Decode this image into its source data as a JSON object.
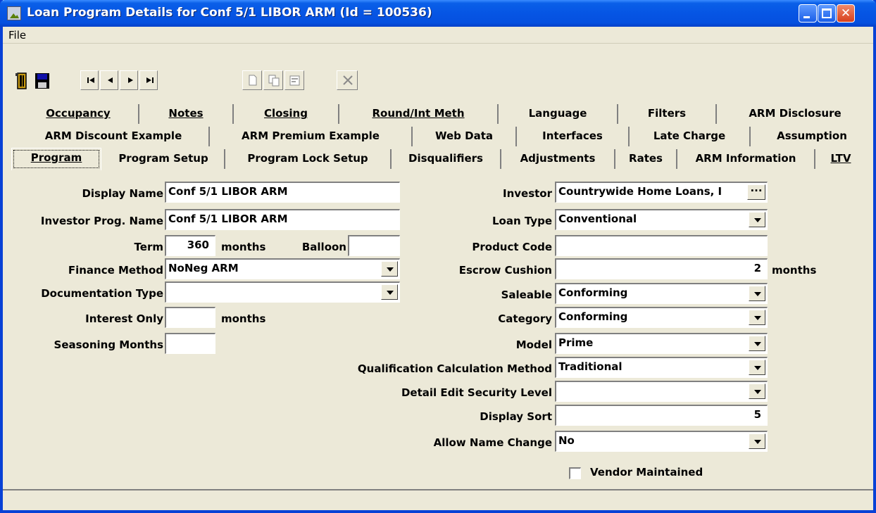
{
  "window": {
    "title": "Loan Program Details for Conf 5/1 LIBOR ARM (Id = 100536)"
  },
  "menu": {
    "file": "File"
  },
  "toolbar": {
    "icons": [
      "exit-icon",
      "save-icon",
      "first-record-icon",
      "prev-record-icon",
      "next-record-icon",
      "last-record-icon",
      "new-icon",
      "copy-icon",
      "properties-icon",
      "delete-icon"
    ]
  },
  "tabs": {
    "row1": [
      "Occupancy",
      "Notes",
      "Closing",
      "Round/Int Meth",
      "Language",
      "Filters",
      "ARM Disclosure"
    ],
    "row2": [
      "ARM Discount Example",
      "ARM Premium Example",
      "Web Data",
      "Interfaces",
      "Late Charge",
      "Assumption"
    ],
    "row3": [
      "Program",
      "Program Setup",
      "Program Lock Setup",
      "Disqualifiers",
      "Adjustments",
      "Rates",
      "ARM Information",
      "LTV"
    ]
  },
  "form": {
    "display_name": {
      "label": "Display Name",
      "value": "Conf 5/1 LIBOR ARM"
    },
    "investor_prog_name": {
      "label": "Investor Prog. Name",
      "value": "Conf 5/1 LIBOR ARM"
    },
    "term": {
      "label": "Term",
      "value": "360",
      "unit": "months"
    },
    "balloon": {
      "label": "Balloon",
      "value": ""
    },
    "finance_method": {
      "label": "Finance Method",
      "value": "NoNeg ARM"
    },
    "documentation_type": {
      "label": "Documentation Type",
      "value": ""
    },
    "interest_only": {
      "label": "Interest Only",
      "value": "",
      "unit": "months"
    },
    "seasoning_months": {
      "label": "Seasoning Months",
      "value": ""
    },
    "investor": {
      "label": "Investor",
      "value": "Countrywide Home Loans, I",
      "button": "···"
    },
    "loan_type": {
      "label": "Loan Type",
      "value": "Conventional"
    },
    "product_code": {
      "label": "Product Code",
      "value": ""
    },
    "escrow_cushion": {
      "label": "Escrow Cushion",
      "value": "2",
      "unit": "months"
    },
    "saleable": {
      "label": "Saleable",
      "value": "Conforming"
    },
    "category": {
      "label": "Category",
      "value": "Conforming"
    },
    "model": {
      "label": "Model",
      "value": "Prime"
    },
    "qualification_calc": {
      "label": "Qualification Calculation Method",
      "value": "Traditional"
    },
    "detail_edit_security": {
      "label": "Detail Edit Security Level",
      "value": ""
    },
    "display_sort": {
      "label": "Display Sort",
      "value": "5"
    },
    "allow_name_change": {
      "label": "Allow Name Change",
      "value": "No"
    },
    "vendor_maintained": {
      "label": "Vendor Maintained",
      "checked": false
    }
  }
}
